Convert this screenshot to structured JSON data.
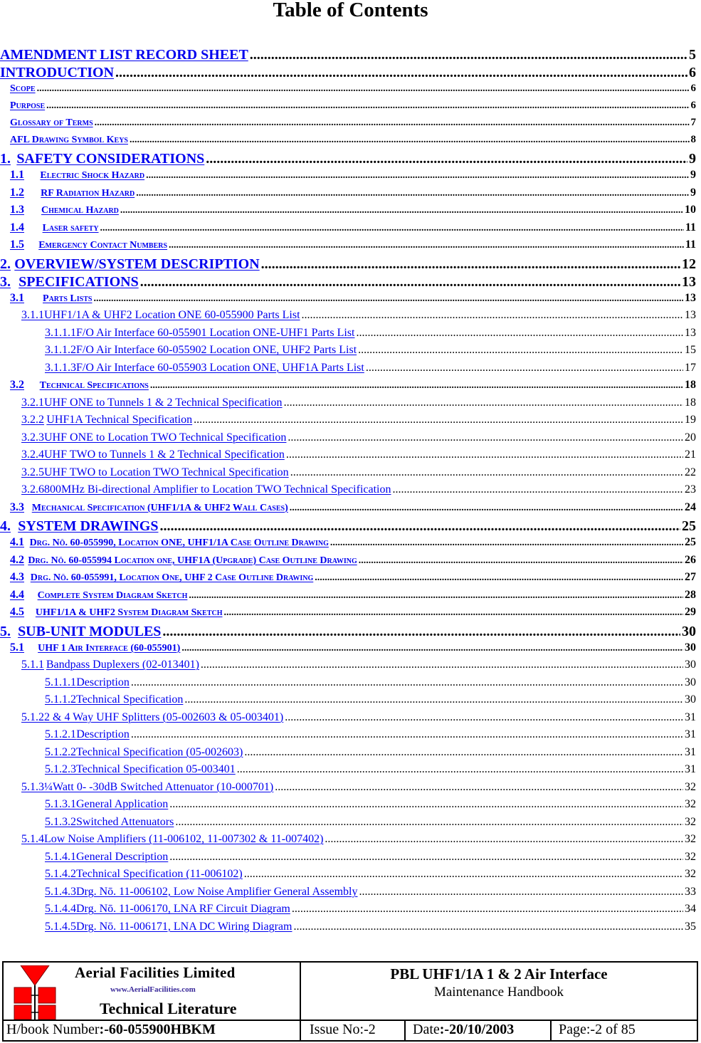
{
  "title": "Table of Contents",
  "link_color": "#0000ee",
  "toc": {
    "top": [
      {
        "label": "AMENDMENT LIST RECORD SHEET",
        "page": "5"
      },
      {
        "label": "INTRODUCTION",
        "page": "6"
      }
    ],
    "intro_items": [
      {
        "label": "Scope",
        "page": "6"
      },
      {
        "label": "Purpose",
        "page": "6"
      },
      {
        "label": "Glossary of Terms",
        "page": "7"
      },
      {
        "label": "AFL Drawing Symbol Keys",
        "page": "8"
      }
    ],
    "s1": {
      "num": "1.",
      "label": "SAFETY CONSIDERATIONS",
      "page": "9",
      "items": [
        {
          "num": "1.1",
          "label": "Electric Shock Hazard",
          "page": "9"
        },
        {
          "num": "1.2",
          "label": "RF Radiation Hazard",
          "page": "9"
        },
        {
          "num": "1.3",
          "label": "Chemical Hazard",
          "page": "10"
        },
        {
          "num": "1.4",
          "label": "Laser safety",
          "page": "11"
        },
        {
          "num": "1.5",
          "label": "Emergency Contact Numbers",
          "page": "11"
        }
      ]
    },
    "s2": {
      "num": "2.",
      "label": "OVERVIEW/SYSTEM DESCRIPTION",
      "page": "12"
    },
    "s3": {
      "num": "3.",
      "label": "SPECIFICATIONS",
      "page": "13",
      "s31": {
        "num": "3.1",
        "label": "Parts Lists",
        "page": "13"
      },
      "s311": {
        "num": "3.1.1",
        "label": "UHF1/1A & UHF2 Location ONE 60-055900 Parts List",
        "page": "13"
      },
      "s311_items": [
        {
          "num": "3.1.1.1",
          "label": "F/O Air Interface 60-055901 Location ONE-UHF1 Parts List",
          "page": "13"
        },
        {
          "num": "3.1.1.2",
          "label": "F/O Air Interface 60-055902 Location ONE, UHF2 Parts List",
          "page": "15"
        },
        {
          "num": "3.1.1.3",
          "label": "F/O Air Interface 60-055903 Location ONE, UHF1A Parts List",
          "page": "17"
        }
      ],
      "s32": {
        "num": "3.2",
        "label": "Technical Specifications",
        "page": "18"
      },
      "s32_items": [
        {
          "num": "3.2.1",
          "label": "UHF ONE to Tunnels 1 & 2 Technical Specification",
          "page": "18"
        },
        {
          "num": "3.2.2",
          "label": "UHF1A Technical Specification",
          "page": "19"
        },
        {
          "num": "3.2.3",
          "label": "UHF ONE to Location TWO Technical Specification",
          "page": "20"
        },
        {
          "num": "3.2.4",
          "label": "UHF TWO to Tunnels 1 & 2 Technical Specification",
          "page": "21"
        },
        {
          "num": "3.2.5",
          "label": "UHF TWO to Location TWO Technical Specification",
          "page": "22"
        },
        {
          "num": "3.2.6",
          "label": "800MHz Bi-directional Amplifier to Location TWO Technical Specification",
          "page": "23"
        }
      ],
      "s33": {
        "num": "3.3",
        "label": "Mechanical Specification (UHF1/1A & UHF2 Wall Cases)",
        "page": "24"
      }
    },
    "s4": {
      "num": "4.",
      "label": "SYSTEM DRAWINGS",
      "page": "25",
      "items": [
        {
          "num": "4.1",
          "label": "Drg. Nō. 60-055990, Location ONE, UHF1/1A Case Outline Drawing",
          "page": "25"
        },
        {
          "num": "4.2",
          "label": "Drg. Nō. 60-055994 Location one, UHF1A (Upgrade) Case Outline Drawing",
          "page": "26"
        },
        {
          "num": "4.3",
          "label": "Drg. Nō. 60-055991, Location One, UHF 2 Case Outline Drawing",
          "page": "27"
        },
        {
          "num": "4.4",
          "label": "Complete System Diagram Sketch",
          "page": "28"
        },
        {
          "num": "4.5",
          "label": "UHF1/1A & UHF2 System Diagram Sketch",
          "page": "29"
        }
      ]
    },
    "s5": {
      "num": "5.",
      "label": "SUB-UNIT MODULES",
      "page": "30",
      "s51": {
        "num": "5.1",
        "label": "UHF 1 Air Interface (60-055901)",
        "page": "30"
      },
      "s511": {
        "num": "5.1.1",
        "label": "Bandpass Duplexers (02-013401)",
        "page": "30"
      },
      "s511_items": [
        {
          "num": "5.1.1.1",
          "label": "Description",
          "page": "30"
        },
        {
          "num": "5.1.1.2",
          "label": "Technical Specification",
          "page": "30"
        }
      ],
      "s512": {
        "num": "5.1.2",
        "label": "2 & 4 Way UHF Splitters (05-002603 & 05-003401)",
        "page": "31"
      },
      "s512_items": [
        {
          "num": "5.1.2.1",
          "label": "Description",
          "page": "31"
        },
        {
          "num": "5.1.2.2",
          "label": "Technical Specification (05-002603)",
          "page": "31"
        },
        {
          "num": "5.1.2.3",
          "label": "Technical Specification 05-003401",
          "page": "31"
        }
      ],
      "s513": {
        "num": "5.1.3",
        "label": "¼Watt 0- -30dB Switched Attenuator (10-000701)",
        "page": "32"
      },
      "s513_items": [
        {
          "num": "5.1.3.1",
          "label": "General Application",
          "page": "32"
        },
        {
          "num": "5.1.3.2",
          "label": "Switched Attenuators",
          "page": "32"
        }
      ],
      "s514": {
        "num": "5.1.4",
        "label": "Low Noise Amplifiers (11-006102, 11-007302 & 11-007402)",
        "page": "32"
      },
      "s514_items": [
        {
          "num": "5.1.4.1",
          "label": "General Description",
          "page": "32"
        },
        {
          "num": "5.1.4.2",
          "label": "Technical Specification (11-006102)",
          "page": "32"
        },
        {
          "num": "5.1.4.3",
          "label": "Drg. Nō. 11-006102, Low Noise Amplifier General Assembly",
          "page": "33"
        },
        {
          "num": "5.1.4.4",
          "label": "Drg. Nō. 11-006170, LNA RF Circuit Diagram",
          "page": "34"
        },
        {
          "num": "5.1.4.5",
          "label": "Drg. Nō. 11-006171, LNA DC Wiring Diagram",
          "page": "35"
        }
      ]
    }
  },
  "footer": {
    "company": "Aerial  Facilities  Limited",
    "website": "www.AerialFacilities.com",
    "literature": "Technical Literature",
    "doc_title": "PBL UHF1/1A 1 & 2 Air Interface",
    "doc_subtitle": "Maintenance Handbook",
    "hbook_label": "H/book Number",
    "hbook_value": ":-60-055900HBKM",
    "issue_label": "Issue No:-",
    "issue_value": "2",
    "date_label": "Date",
    "date_value": ":-20/10/2003",
    "page_label": "Page:-",
    "page_value": "2 of 85",
    "logo_colors": {
      "red": "#ff0000"
    }
  }
}
